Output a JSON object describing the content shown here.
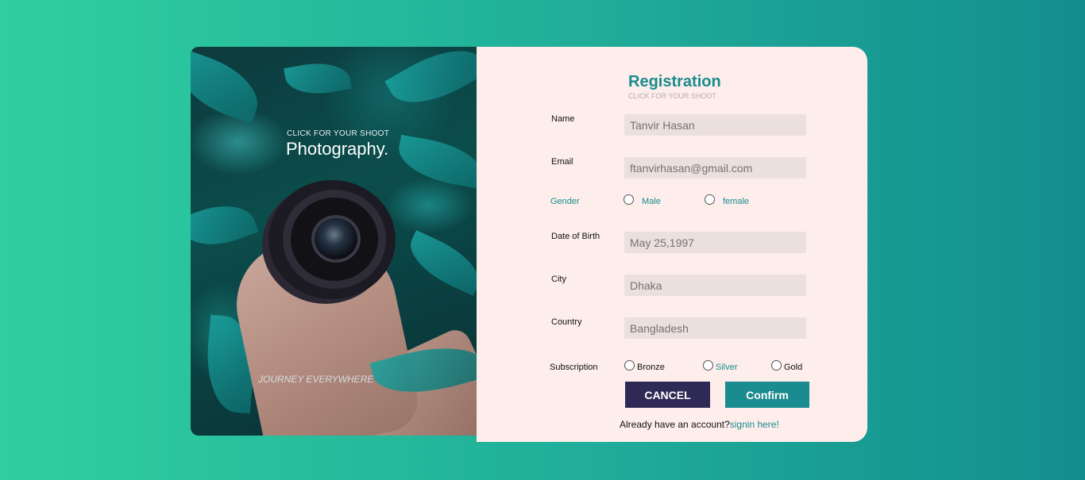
{
  "photo": {
    "kicker": "CLICK FOR YOUR SHOOT",
    "title": "Photography.",
    "footer": "JOURNEY EVERYWHERE"
  },
  "form": {
    "title": "Registration",
    "subtitle": "CLICK FOR YOUR SHOOT",
    "name_label": "Name",
    "name_value": "Tanvir Hasan",
    "email_label": "Email",
    "email_value": "ftanvirhasan@gmail.com",
    "gender_label": "Gender",
    "gender_options": [
      "Male",
      "female"
    ],
    "dob_label": "Date of Birth",
    "dob_value": "May 25,1997",
    "city_label": "City",
    "city_value": "Dhaka",
    "country_label": "Country",
    "country_value": "Bangladesh",
    "subscription_label": "Subscription",
    "subscription_options": [
      "Bronze",
      "Silver",
      "Gold"
    ],
    "cancel_label": "CANCEL",
    "confirm_label": "Confirm",
    "signin_prompt": "Already have an account?",
    "signin_link": "signin here!"
  },
  "colors": {
    "accent": "#1a8b8e",
    "cancel_button": "#2f2a55",
    "panel_bg": "#fdeeec",
    "input_bg": "#ece0df"
  }
}
